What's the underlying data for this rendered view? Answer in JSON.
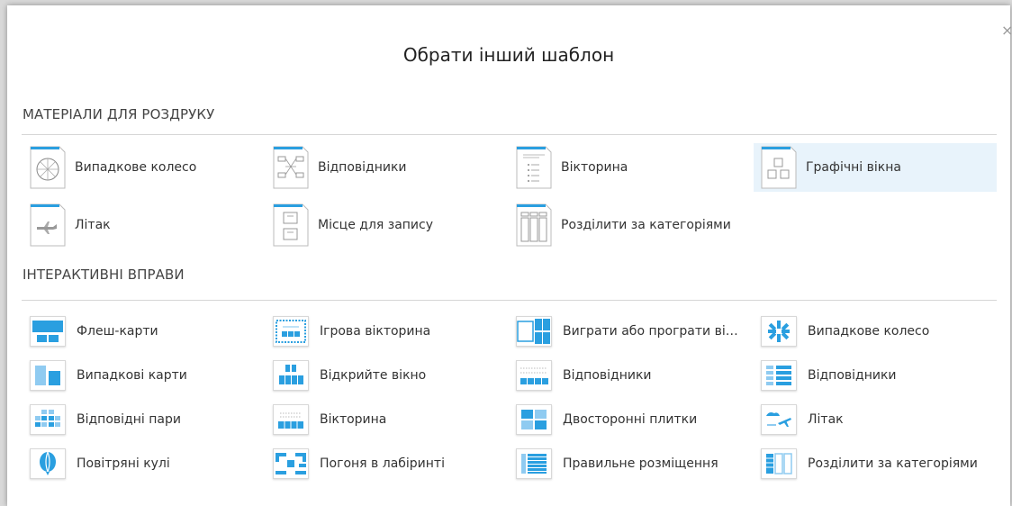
{
  "modal": {
    "title": "Обрати інший шаблон",
    "close_glyph": "×"
  },
  "printables": {
    "heading": "МАТЕРІАЛИ ДЛЯ РОЗДРУКУ",
    "items": [
      {
        "label": "Випадкове колесо",
        "icon": "spinner-wheel-icon"
      },
      {
        "label": "Відповідники",
        "icon": "match-up-icon"
      },
      {
        "label": "Вікторина",
        "icon": "quiz-icon"
      },
      {
        "label": "Графічні вікна",
        "icon": "image-boxes-icon",
        "highlighted": true
      },
      {
        "label": "Літак",
        "icon": "airplane-icon"
      },
      {
        "label": "Місце для запису",
        "icon": "write-space-icon"
      },
      {
        "label": "Розділити за категоріями",
        "icon": "group-sort-icon"
      }
    ]
  },
  "interactives": {
    "heading": "ІНТЕРАКТИВНІ ВПРАВИ",
    "items": [
      {
        "label": "Флеш-карти",
        "icon": "flash-cards-icon"
      },
      {
        "label": "Ігрова вікторина",
        "icon": "gameshow-quiz-icon"
      },
      {
        "label": "Виграти або програти вікт...",
        "icon": "win-or-lose-quiz-icon"
      },
      {
        "label": "Випадкове колесо",
        "icon": "spinner-wheel-icon"
      },
      {
        "label": "Випадкові карти",
        "icon": "random-cards-icon"
      },
      {
        "label": "Відкрийте вікно",
        "icon": "open-the-box-icon"
      },
      {
        "label": "Відповідники",
        "icon": "match-up-icon"
      },
      {
        "label": "Відповідники",
        "icon": "labelled-diagram-icon"
      },
      {
        "label": "Відповідні пари",
        "icon": "matching-pairs-icon"
      },
      {
        "label": "Вікторина",
        "icon": "quiz-icon"
      },
      {
        "label": "Двосторонні плитки",
        "icon": "flip-tiles-icon"
      },
      {
        "label": "Літак",
        "icon": "airplane-icon"
      },
      {
        "label": "Повітряні кулі",
        "icon": "balloon-pop-icon"
      },
      {
        "label": "Погоня в лабіринті",
        "icon": "maze-chase-icon"
      },
      {
        "label": "Правильне розміщення",
        "icon": "rank-order-icon"
      },
      {
        "label": "Розділити за категоріями",
        "icon": "group-sort-icon"
      }
    ]
  },
  "colors": {
    "accent": "#2a9fe0",
    "highlight": "#e8f3fb"
  }
}
